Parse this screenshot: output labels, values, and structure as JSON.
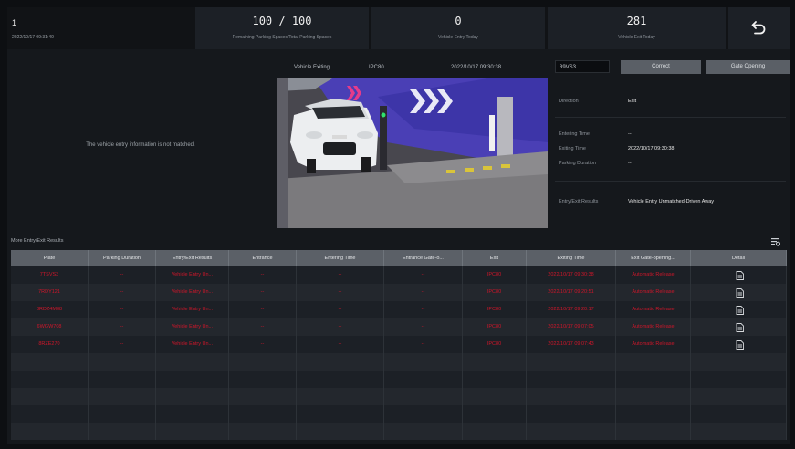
{
  "topbar": {
    "channel": "1",
    "datetime": "2022/10/17 09:31:40",
    "stats": [
      {
        "value": "100 / 100",
        "label": "Remaining Parking Spaces/Total Parking Spaces"
      },
      {
        "value": "0",
        "label": "Vehicle Entry Today"
      },
      {
        "value": "281",
        "label": "Vehicle Exit Today"
      }
    ]
  },
  "left_panel": {
    "message": "The vehicle entry information is not matched."
  },
  "camera": {
    "title": "Vehicle Exiting",
    "channel": "IPC80",
    "timestamp": "2022/10/17 09:30:38"
  },
  "info": {
    "plate_value": "39VS3",
    "correct_label": "Correct",
    "gate_label": "Gate Opening",
    "direction_label": "Direction",
    "direction_value": "Exit",
    "entering_time_label": "Entering Time",
    "entering_time_value": "--",
    "exiting_time_label": "Exiting Time",
    "exiting_time_value": "2022/10/17 09:30:38",
    "parking_duration_label": "Parking Duration",
    "parking_duration_value": "--",
    "result_label": "Entry/Exit Results",
    "result_value": "Vehicle Entry Unmatched-Driven Away"
  },
  "results": {
    "title": "More Entry/Exit Results",
    "columns": [
      "Plate",
      "Parking Duration",
      "Entry/Exit Results",
      "Entrance",
      "Entering Time",
      "Entrance Gate-o...",
      "Exit",
      "Exiting Time",
      "Exit Gate-opening...",
      "Detail"
    ],
    "rows": [
      [
        "7TSVS3",
        "--",
        "Vehicle Entry Un...",
        "--",
        "--",
        "--",
        "IPC80",
        "2022/10/17 09:30:38",
        "Automatic Release",
        "doc-icon"
      ],
      [
        "7RDY121",
        "--",
        "Vehicle Entry Un...",
        "--",
        "--",
        "--",
        "IPC80",
        "2022/10/17 09:20:51",
        "Automatic Release",
        "doc-icon"
      ],
      [
        "8RDZ4M08",
        "--",
        "Vehicle Entry Un...",
        "--",
        "--",
        "--",
        "IPC80",
        "2022/10/17 09:20:17",
        "Automatic Release",
        "doc-icon"
      ],
      [
        "6WGW708",
        "--",
        "Vehicle Entry Un...",
        "--",
        "--",
        "--",
        "IPC80",
        "2022/10/17 09:07:05",
        "Automatic Release",
        "doc-icon"
      ],
      [
        "8RZE270",
        "--",
        "Vehicle Entry Un...",
        "--",
        "--",
        "--",
        "IPC80",
        "2022/10/17 09:07:43",
        "Automatic Release",
        "doc-icon"
      ]
    ],
    "empty_rows": 5
  }
}
